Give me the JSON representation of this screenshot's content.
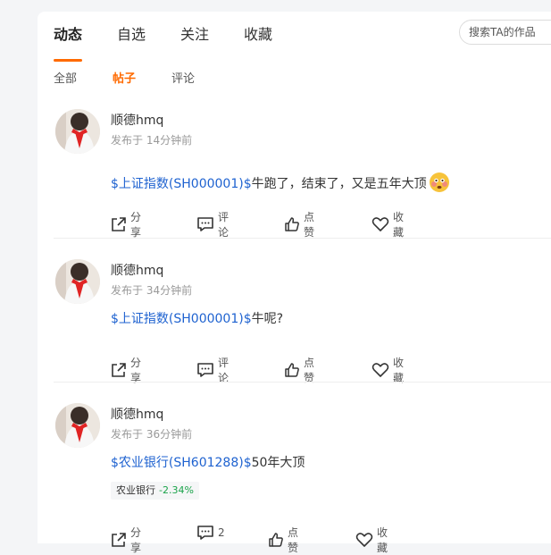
{
  "tabs": [
    "动态",
    "自选",
    "关注",
    "收藏"
  ],
  "search": {
    "placeholder": "搜索TA的作品"
  },
  "subtabs": [
    "全部",
    "帖子",
    "评论"
  ],
  "colors": {
    "accent": "#ff6a00",
    "link": "#1e62d0",
    "down": "#1aa34a"
  },
  "posts": [
    {
      "user": "顺德hmq",
      "time": "发布于 14分钟前",
      "link": "$上证指数(SH000001)$",
      "text": "牛跑了，结束了，又是五年大顶",
      "emoji": "flushed-face-icon",
      "actions": {
        "share": "分享",
        "comment": "评论",
        "like": "点赞",
        "collect": "收藏"
      }
    },
    {
      "user": "顺德hmq",
      "time": "发布于 34分钟前",
      "link": "$上证指数(SH000001)$",
      "text": "牛呢?",
      "actions": {
        "share": "分享",
        "comment": "评论",
        "like": "点赞",
        "collect": "收藏"
      }
    },
    {
      "user": "顺德hmq",
      "time": "发布于 36分钟前",
      "link": "$农业银行(SH601288)$",
      "text": "50年大顶",
      "quote": {
        "name": "农业银行",
        "change": "-2.34%"
      },
      "actions": {
        "share": "分享",
        "comment": "2",
        "like": "点赞",
        "collect": "收藏"
      }
    }
  ]
}
